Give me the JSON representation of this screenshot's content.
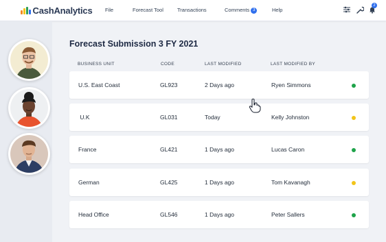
{
  "app": {
    "brand": "CashAnalytics"
  },
  "nav": {
    "file": "File",
    "forecast_tool": "Forecast Tool",
    "transactions": "Transactions",
    "comments": "Comments",
    "comments_count": "3",
    "help": "Help",
    "notifications_count": "2"
  },
  "icons": {
    "filters": "filters-icon",
    "wrench": "wrench-icon",
    "bell": "bell-icon",
    "cursor": "hand-pointer-icon"
  },
  "page": {
    "title": "Forecast Submission 3 FY 2021"
  },
  "table": {
    "headers": [
      "BUSINESS UNIT",
      "CODE",
      "LAST MODIFIED",
      "LAST MODIFIED BY"
    ],
    "rows": [
      {
        "unit": "U.S. East Coast",
        "code": "GL923",
        "modified": "2 Days ago",
        "by": "Ryen Simmons",
        "status": "green"
      },
      {
        "unit": " U.K",
        "code": "GL031",
        "modified": "Today",
        "by": "Kelly Johnston",
        "status": "yellow"
      },
      {
        "unit": "France",
        "code": "GL421",
        "modified": "1 Days ago",
        "by": "Lucas Caron",
        "status": "green"
      },
      {
        "unit": "German",
        "code": "GL425",
        "modified": "1 Days ago",
        "by": "Tom Kavanagh",
        "status": "yellow"
      },
      {
        "unit": "Head Office",
        "code": "GL546",
        "modified": "1 Days ago",
        "by": "Peter Sallers",
        "status": "green"
      }
    ]
  },
  "colors": {
    "accent": "#2f6fed",
    "status_green": "#1fa34a",
    "status_yellow": "#f2c419",
    "brand_bars": [
      "#f28a24",
      "#f2c419",
      "#2f9e57",
      "#2f6fed"
    ]
  }
}
